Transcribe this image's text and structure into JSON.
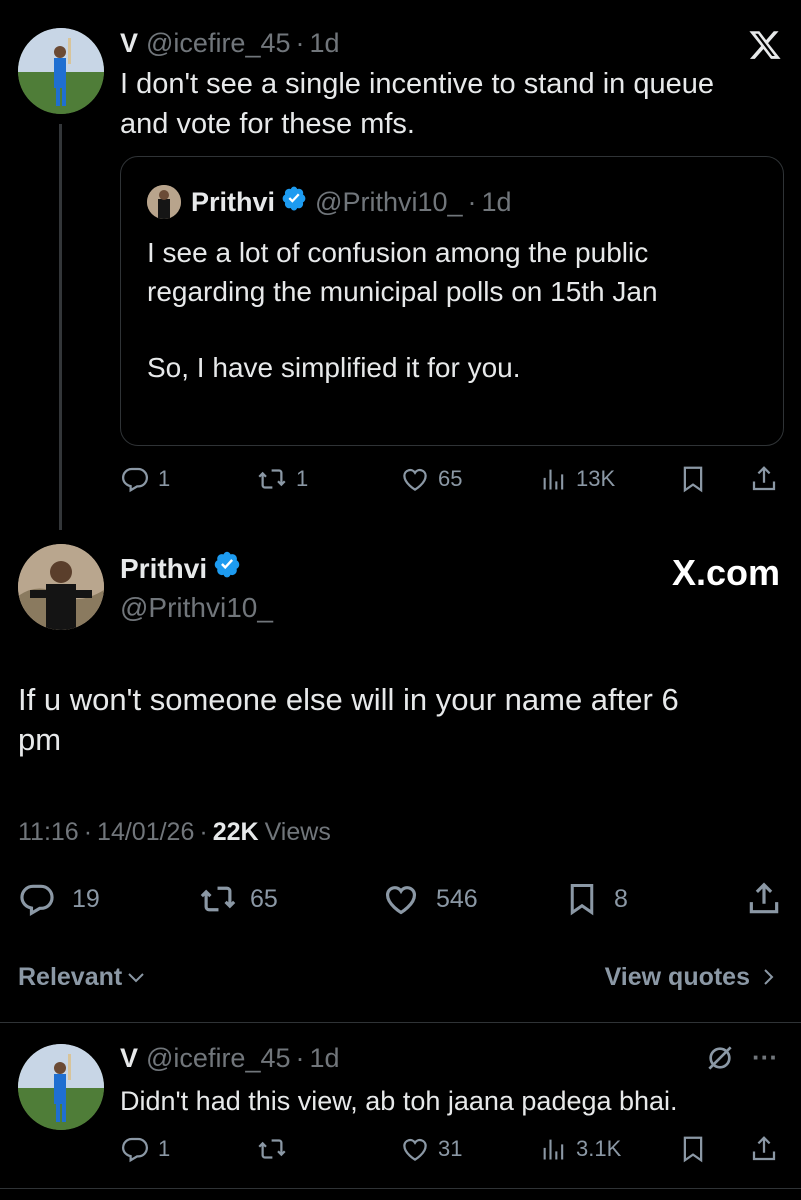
{
  "brand": {
    "logo": "X",
    "watermark": "X.com"
  },
  "thread_parent": {
    "display_name": "V",
    "handle": "@icefire_45",
    "time": "1d",
    "sep": "·",
    "text_lines": [
      "I don't see a single incentive to stand in queue",
      "and vote for these mfs."
    ],
    "quote": {
      "display_name": "Prithvi",
      "handle": "@Prithvi10_",
      "time": "1d",
      "sep": "·",
      "lines": [
        "I see a lot of confusion among the public",
        "regarding the municipal polls on 15th Jan",
        "So, I have simplified it for you."
      ]
    },
    "actions": {
      "replies": "1",
      "reposts": "1",
      "likes": "65",
      "views": "13K"
    }
  },
  "main_post": {
    "display_name": "Prithvi",
    "handle": "@Prithvi10_",
    "text_lines": [
      "If u won't someone else will in your name after 6",
      "pm"
    ],
    "time": "11:16",
    "date": "14/01/26",
    "sep": "·",
    "views_count": "22K",
    "views_label": "Views",
    "actions": {
      "replies": "19",
      "reposts": "65",
      "likes": "546",
      "bookmarks": "8"
    }
  },
  "filters": {
    "sort_label": "Relevant",
    "view_quotes": "View quotes"
  },
  "reply": {
    "display_name": "V",
    "handle": "@icefire_45",
    "time": "1d",
    "sep": "·",
    "more": "···",
    "text": "Didn't had this view, ab toh jaana padega bhai.",
    "actions": {
      "replies": "1",
      "likes": "31",
      "views": "3.1K"
    }
  },
  "colors": {
    "background": "#000000",
    "text": "#e7e9ea",
    "muted": "#71767b",
    "verified": "#1d9bf0",
    "divider": "#2f3336"
  }
}
